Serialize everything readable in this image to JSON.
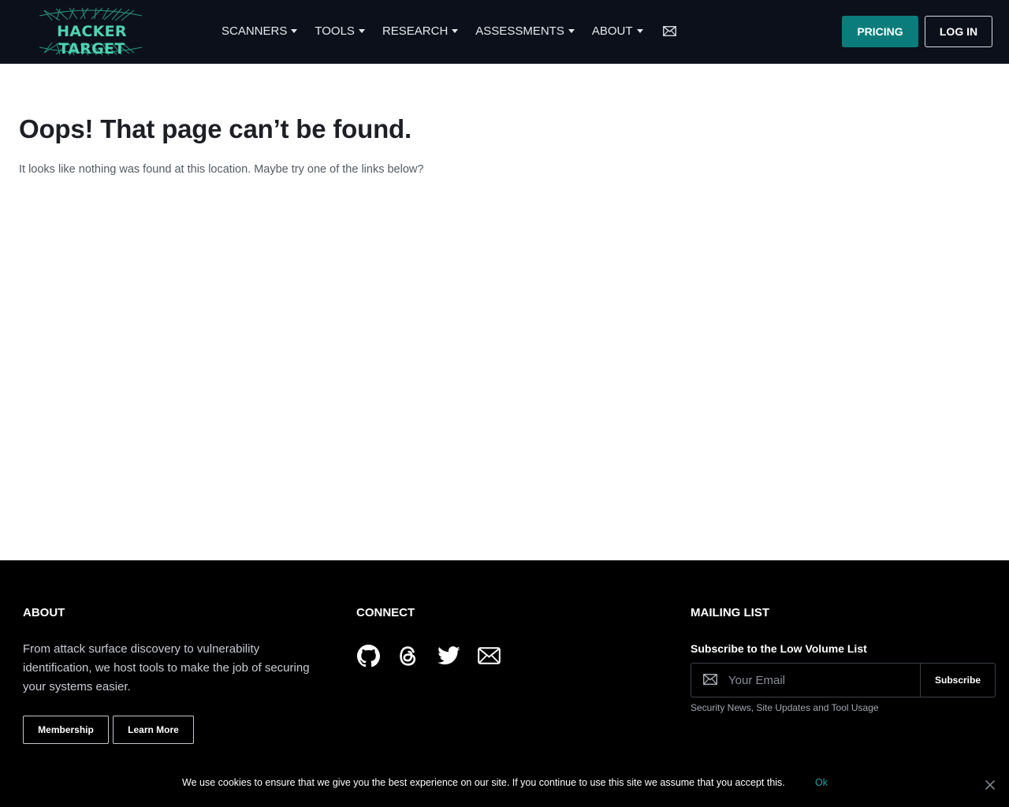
{
  "header": {
    "logo_text": "HACKER TARGET",
    "nav": [
      {
        "label": "SCANNERS"
      },
      {
        "label": "TOOLS"
      },
      {
        "label": "RESEARCH"
      },
      {
        "label": "ASSESSMENTS"
      },
      {
        "label": "ABOUT"
      }
    ],
    "pricing_label": "PRICING",
    "login_label": "LOG IN",
    "accent_color": "#0a7c7c"
  },
  "main": {
    "title": "Oops! That page can’t be found.",
    "text": "It looks like nothing was found at this location. Maybe try one of the links below?"
  },
  "footer": {
    "about": {
      "heading": "ABOUT",
      "text": "From attack surface discovery to vulnerability identification, we host tools to make the job of securing your systems easier.",
      "membership_label": "Membership",
      "learn_more_label": "Learn More"
    },
    "connect": {
      "heading": "CONNECT",
      "icons": [
        "github-icon",
        "threads-icon",
        "twitter-icon",
        "email-icon"
      ]
    },
    "mailing": {
      "heading": "MAILING LIST",
      "subscribe_heading": "Subscribe to the Low Volume List",
      "email_placeholder": "Your Email",
      "subscribe_label": "Subscribe",
      "note": "Security News, Site Updates and Tool Usage"
    }
  },
  "cookie": {
    "text": "We use cookies to ensure that we give you the best experience on our site. If you continue to use this site we assume that you accept this.",
    "ok_label": "Ok"
  }
}
